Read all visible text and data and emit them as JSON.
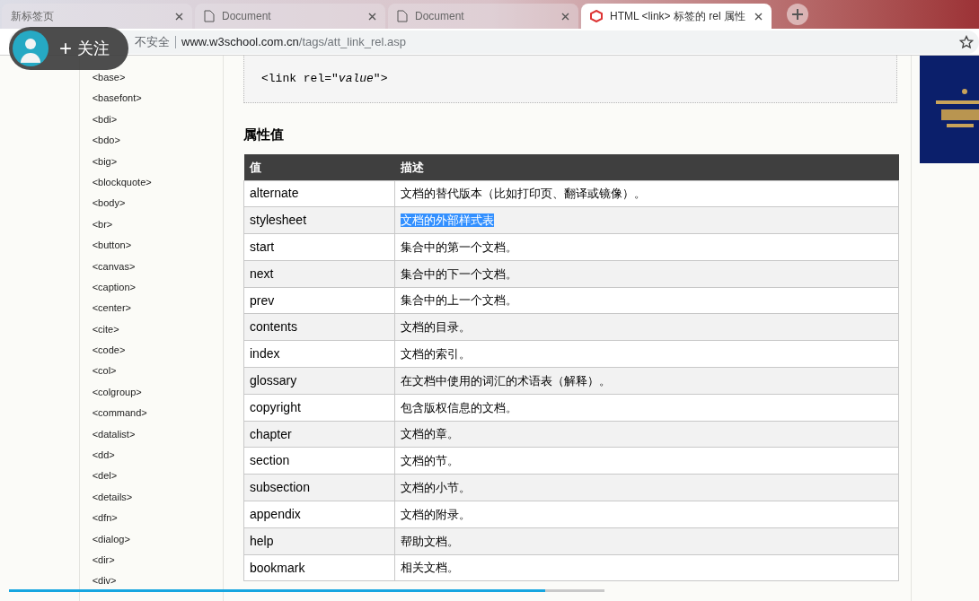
{
  "tabs": [
    {
      "title": "新标签页",
      "kind": "blank",
      "selected": false
    },
    {
      "title": "Document",
      "kind": "document",
      "selected": false
    },
    {
      "title": "Document",
      "kind": "document",
      "selected": false
    },
    {
      "title": "HTML <link> 标签的 rel 属性",
      "kind": "site",
      "selected": true
    }
  ],
  "address_bar": {
    "security": "不安全",
    "host": "www.w3school.com.cn",
    "path": "/tags/att_link_rel.asp"
  },
  "follow_overlay": {
    "label": "关注",
    "plus": "+"
  },
  "sidebar": {
    "items": [
      "<base>",
      "<basefont>",
      "<bdi>",
      "<bdo>",
      "<big>",
      "<blockquote>",
      "<body>",
      "<br>",
      "<button>",
      "<canvas>",
      "<caption>",
      "<center>",
      "<cite>",
      "<code>",
      "<col>",
      "<colgroup>",
      "<command>",
      "<datalist>",
      "<dd>",
      "<del>",
      "<details>",
      "<dfn>",
      "<dialog>",
      "<dir>",
      "<div>"
    ]
  },
  "code_sample": "<link rel=\"*value*\">",
  "section_heading": "属性值",
  "table": {
    "columns": [
      "值",
      "描述"
    ],
    "rows": [
      {
        "value": "alternate",
        "description": "文档的替代版本（比如打印页、翻译或镜像）。",
        "text_selected": false
      },
      {
        "value": "stylesheet",
        "description": "文档的外部样式表",
        "text_selected": true
      },
      {
        "value": "start",
        "description": "集合中的第一个文档。",
        "text_selected": false
      },
      {
        "value": "next",
        "description": "集合中的下一个文档。",
        "text_selected": false
      },
      {
        "value": "prev",
        "description": "集合中的上一个文档。",
        "text_selected": false
      },
      {
        "value": "contents",
        "description": "文档的目录。",
        "text_selected": false
      },
      {
        "value": "index",
        "description": "文档的索引。",
        "text_selected": false
      },
      {
        "value": "glossary",
        "description": "在文档中使用的词汇的术语表（解释）。",
        "text_selected": false
      },
      {
        "value": "copyright",
        "description": "包含版权信息的文档。",
        "text_selected": false
      },
      {
        "value": "chapter",
        "description": "文档的章。",
        "text_selected": false
      },
      {
        "value": "section",
        "description": "文档的节。",
        "text_selected": false
      },
      {
        "value": "subsection",
        "description": "文档的小节。",
        "text_selected": false
      },
      {
        "value": "appendix",
        "description": "文档的附录。",
        "text_selected": false
      },
      {
        "value": "help",
        "description": "帮助文档。",
        "text_selected": false
      },
      {
        "value": "bookmark",
        "description": "相关文档。",
        "text_selected": false
      }
    ]
  },
  "video_progress": {
    "level": 0.9
  }
}
